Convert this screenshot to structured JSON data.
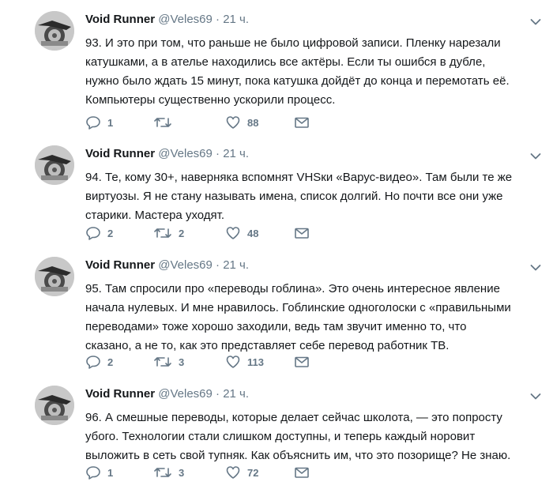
{
  "tweets": [
    {
      "author": "Void Runner",
      "handle": "@Veles69",
      "dot": "·",
      "time": "21 ч.",
      "lines": [
        "93. И это при том, что раньше не было цифровой записи. Пленку нарезали",
        "катушками, а в ателье находились все актёры. Если ты ошибся в дубле,",
        "нужно было ждать 15 минут, пока катушка дойдёт до конца и перемотать её.",
        "Компьютеры существенно ускорили процесс."
      ],
      "replies": "1",
      "retweets": "",
      "likes": "88"
    },
    {
      "author": "Void Runner",
      "handle": "@Veles69",
      "dot": "·",
      "time": "21 ч.",
      "lines": [
        "94. Те, кому 30+, наверняка вспомнят VHSки «Варус-видео». Там были те же",
        "виртуозы. Я не стану называть имена, список долгий. Но почти все они уже",
        "старики. Мастера уходят."
      ],
      "replies": "2",
      "retweets": "2",
      "likes": "48"
    },
    {
      "author": "Void Runner",
      "handle": "@Veles69",
      "dot": "·",
      "time": "21 ч.",
      "lines": [
        "95. Там спросили про «переводы гоблина». Это очень интересное явление",
        "начала нулевых. И мне нравилось. Гоблинские одноголоски с «правильными",
        "переводами» тоже хорошо заходили, ведь там звучит именно то, что",
        "сказано, а не то, как это представляет себе перевод работник ТВ."
      ],
      "replies": "2",
      "retweets": "3",
      "likes": "113"
    },
    {
      "author": "Void Runner",
      "handle": "@Veles69",
      "dot": "·",
      "time": "21 ч.",
      "lines": [
        "96. А смешные переводы, которые делает сейчас школота, — это попросту",
        "убого. Технологии стали слишком доступны, и теперь каждый норовит",
        "выложить в сеть свой тупняк. Как объяснить им, что это позорище? Не знаю."
      ],
      "replies": "1",
      "retweets": "3",
      "likes": "72"
    }
  ],
  "icons": {
    "reply": "reply-icon",
    "retweet": "retweet-icon",
    "like": "like-icon",
    "dm": "envelope-icon",
    "caret": "chevron-down-icon"
  },
  "colors": {
    "icon": "#657786",
    "text": "#14171a",
    "muted": "#657786",
    "divider": "#e6ecf0"
  }
}
